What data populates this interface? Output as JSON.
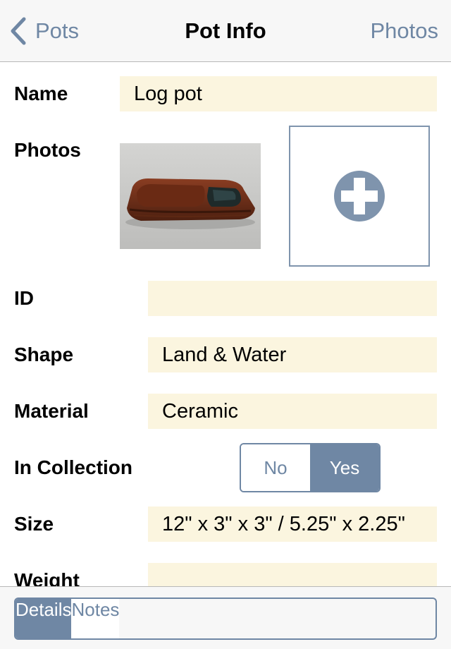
{
  "navbar": {
    "back_label": "Pots",
    "title": "Pot Info",
    "right_label": "Photos"
  },
  "form": {
    "name": {
      "label": "Name",
      "value": "Log pot"
    },
    "photos": {
      "label": "Photos",
      "add_icon": "plus-circle-icon"
    },
    "id": {
      "label": "ID",
      "value": ""
    },
    "shape": {
      "label": "Shape",
      "value": "Land & Water"
    },
    "material": {
      "label": "Material",
      "value": "Ceramic"
    },
    "in_collection": {
      "label": "In Collection",
      "options": [
        "No",
        "Yes"
      ],
      "selected": "Yes"
    },
    "size": {
      "label": "Size",
      "value": "12\" x 3\" x 3\" / 5.25\" x 2.25\""
    },
    "weight": {
      "label": "Weight",
      "value": ""
    }
  },
  "toolbar": {
    "tabs": [
      "Details",
      "Notes"
    ],
    "selected": "Details"
  },
  "colors": {
    "accent": "#6f87a4",
    "field_bg": "#fbf5df",
    "bar_bg": "#f7f7f7"
  }
}
